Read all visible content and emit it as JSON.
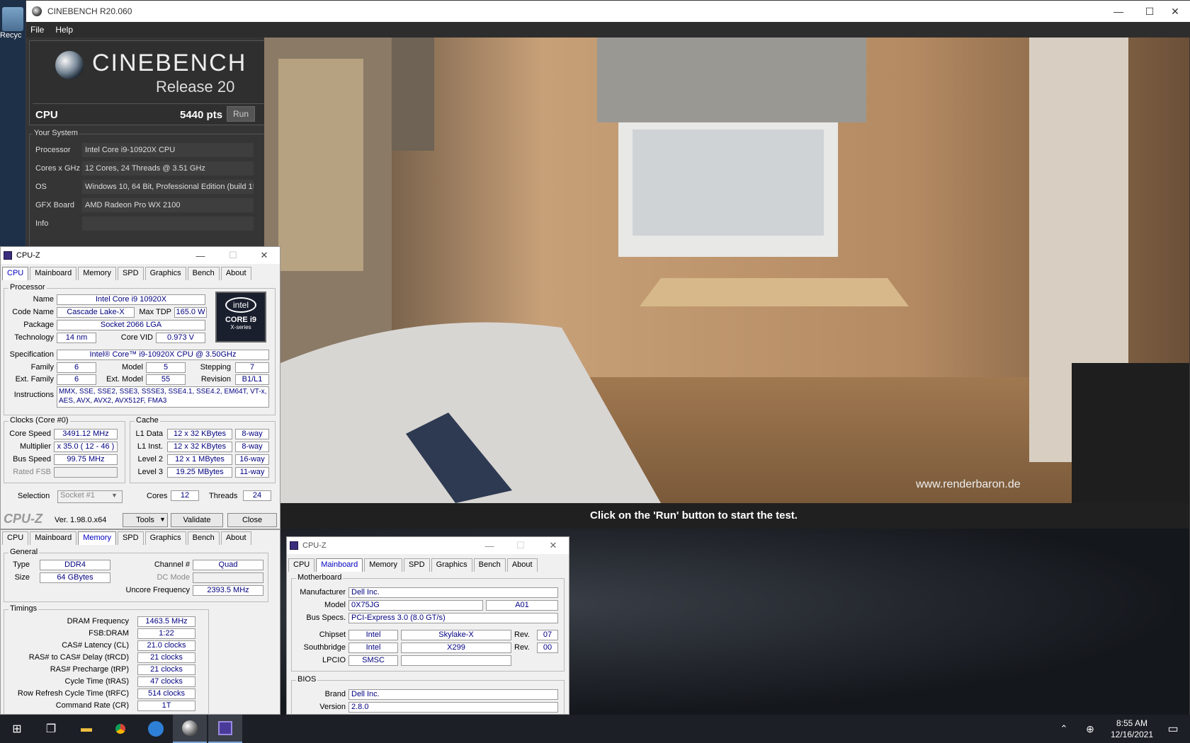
{
  "desktop": {
    "recycle_label": "Recyc"
  },
  "cinebench": {
    "title": "CINEBENCH R20.060",
    "menu": [
      "File",
      "Help"
    ],
    "brand": "CINEBENCH",
    "release": "Release 20",
    "cpu_label": "CPU",
    "score": "5440 pts",
    "run_label": "Run",
    "your_system": "Your System",
    "system": [
      {
        "key": "Processor",
        "value": "Intel Core i9-10920X CPU"
      },
      {
        "key": "Cores x GHz",
        "value": "12 Cores, 24 Threads @ 3.51 GHz"
      },
      {
        "key": "OS",
        "value": "Windows 10, 64 Bit, Professional Edition (build 1!"
      },
      {
        "key": "GFX Board",
        "value": "AMD Radeon Pro WX 2100"
      },
      {
        "key": "Info",
        "value": ""
      }
    ],
    "watermark": "www.renderbaron.de",
    "message": "Click on the 'Run' button to start the test."
  },
  "cpuz_cpu": {
    "title": "CPU-Z",
    "tabs": [
      "CPU",
      "Mainboard",
      "Memory",
      "SPD",
      "Graphics",
      "Bench",
      "About"
    ],
    "active_tab": "CPU",
    "processor_group": "Processor",
    "name_lbl": "Name",
    "name": "Intel Core i9 10920X",
    "codename_lbl": "Code Name",
    "codename": "Cascade Lake-X",
    "maxtdp_lbl": "Max TDP",
    "maxtdp": "165.0 W",
    "package_lbl": "Package",
    "package": "Socket 2066 LGA",
    "tech_lbl": "Technology",
    "tech": "14 nm",
    "corevid_lbl": "Core VID",
    "corevid": "0.973 V",
    "spec_lbl": "Specification",
    "spec": "Intel® Core™ i9-10920X CPU @ 3.50GHz",
    "family_lbl": "Family",
    "family": "6",
    "model_lbl": "Model",
    "model": "5",
    "stepping_lbl": "Stepping",
    "stepping": "7",
    "extfamily_lbl": "Ext. Family",
    "extfamily": "6",
    "extmodel_lbl": "Ext. Model",
    "extmodel": "55",
    "revision_lbl": "Revision",
    "revision": "B1/L1",
    "instr_lbl": "Instructions",
    "instr1": "MMX, SSE, SSE2, SSE3, SSSE3, SSE4.1, SSE4.2, EM64T, VT-x,",
    "instr2": "AES, AVX, AVX2, AVX512F, FMA3",
    "badge_brand": "intel",
    "badge_core": "CORE i9",
    "badge_series": "X-series",
    "clocks_group": "Clocks (Core #0)",
    "corespeed_lbl": "Core Speed",
    "corespeed": "3491.12 MHz",
    "mult_lbl": "Multiplier",
    "mult": "x 35.0 ( 12 - 46 )",
    "busspeed_lbl": "Bus Speed",
    "busspeed": "99.75 MHz",
    "ratedfsb_lbl": "Rated FSB",
    "ratedfsb": "",
    "cache_group": "Cache",
    "l1d_lbl": "L1 Data",
    "l1d": "12 x 32 KBytes",
    "l1d_way": "8-way",
    "l1i_lbl": "L1 Inst.",
    "l1i": "12 x 32 KBytes",
    "l1i_way": "8-way",
    "l2_lbl": "Level 2",
    "l2": "12 x 1 MBytes",
    "l2_way": "16-way",
    "l3_lbl": "Level 3",
    "l3": "19.25 MBytes",
    "l3_way": "11-way",
    "selection_lbl": "Selection",
    "selection": "Socket #1",
    "cores_lbl": "Cores",
    "cores": "12",
    "threads_lbl": "Threads",
    "threads": "24",
    "logo": "CPU-Z",
    "version": "Ver. 1.98.0.x64",
    "tools": "Tools",
    "validate": "Validate",
    "close": "Close"
  },
  "cpuz_mem": {
    "tabs": [
      "CPU",
      "Mainboard",
      "Memory",
      "SPD",
      "Graphics",
      "Bench",
      "About"
    ],
    "general_group": "General",
    "type_lbl": "Type",
    "type": "DDR4",
    "channel_lbl": "Channel #",
    "channel": "Quad",
    "size_lbl": "Size",
    "size": "64 GBytes",
    "dcmode_lbl": "DC Mode",
    "dcmode": "",
    "uncore_lbl": "Uncore Frequency",
    "uncore": "2393.5 MHz",
    "timings_group": "Timings",
    "timings": [
      {
        "k": "DRAM Frequency",
        "v": "1463.5 MHz"
      },
      {
        "k": "FSB:DRAM",
        "v": "1:22"
      },
      {
        "k": "CAS# Latency (CL)",
        "v": "21.0 clocks"
      },
      {
        "k": "RAS# to CAS# Delay (tRCD)",
        "v": "21 clocks"
      },
      {
        "k": "RAS# Precharge (tRP)",
        "v": "21 clocks"
      },
      {
        "k": "Cycle Time (tRAS)",
        "v": "47 clocks"
      },
      {
        "k": "Row Refresh Cycle Time (tRFC)",
        "v": "514 clocks"
      },
      {
        "k": "Command Rate (CR)",
        "v": "1T"
      }
    ]
  },
  "cpuz_mb": {
    "title": "CPU-Z",
    "tabs": [
      "CPU",
      "Mainboard",
      "Memory",
      "SPD",
      "Graphics",
      "Bench",
      "About"
    ],
    "mb_group": "Motherboard",
    "manufacturer_lbl": "Manufacturer",
    "manufacturer": "Dell Inc.",
    "model_lbl": "Model",
    "model": "0X75JG",
    "model_rev": "A01",
    "busspecs_lbl": "Bus Specs.",
    "busspecs": "PCI-Express 3.0 (8.0 GT/s)",
    "chipset_lbl": "Chipset",
    "chipset_vendor": "Intel",
    "chipset": "Skylake-X",
    "rev_lbl": "Rev.",
    "chipset_rev": "07",
    "sb_lbl": "Southbridge",
    "sb_vendor": "Intel",
    "sb": "X299",
    "sb_rev": "00",
    "lpcio_lbl": "LPCIO",
    "lpcio": "SMSC",
    "bios_group": "BIOS",
    "brand_lbl": "Brand",
    "brand": "Dell Inc.",
    "version_lbl": "Version",
    "version": "2.8.0"
  },
  "taskbar": {
    "time": "8:55 AM",
    "date": "12/16/2021"
  }
}
